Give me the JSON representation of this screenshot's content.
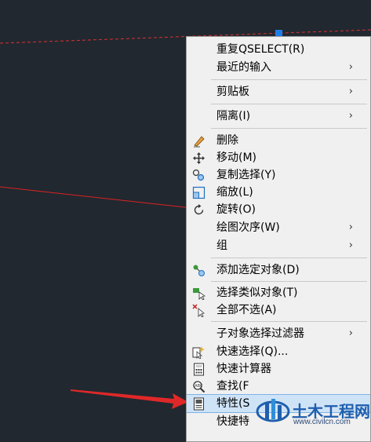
{
  "context_menu": {
    "items": [
      {
        "label": "重复QSELECT(R)",
        "icon": "",
        "submenu": false
      },
      {
        "label": "最近的输入",
        "icon": "",
        "submenu": true
      },
      {
        "label": "剪贴板",
        "icon": "",
        "submenu": true
      },
      {
        "label": "隔离(I)",
        "icon": "",
        "submenu": true
      },
      {
        "label": "删除",
        "icon": "eraser-icon",
        "submenu": false
      },
      {
        "label": "移动(M)",
        "icon": "move-icon",
        "submenu": false
      },
      {
        "label": "复制选择(Y)",
        "icon": "copy-icon",
        "submenu": false
      },
      {
        "label": "缩放(L)",
        "icon": "scale-icon",
        "submenu": false
      },
      {
        "label": "旋转(O)",
        "icon": "rotate-icon",
        "submenu": false
      },
      {
        "label": "绘图次序(W)",
        "icon": "",
        "submenu": true
      },
      {
        "label": "组",
        "icon": "",
        "submenu": true
      },
      {
        "label": "添加选定对象(D)",
        "icon": "add-selected-icon",
        "submenu": false
      },
      {
        "label": "选择类似对象(T)",
        "icon": "select-similar-icon",
        "submenu": false
      },
      {
        "label": "全部不选(A)",
        "icon": "deselect-all-icon",
        "submenu": false
      },
      {
        "label": "子对象选择过滤器",
        "icon": "",
        "submenu": true
      },
      {
        "label": "快速选择(Q)...",
        "icon": "quick-select-icon",
        "submenu": false
      },
      {
        "label": "快速计算器",
        "icon": "calculator-icon",
        "submenu": false
      },
      {
        "label": "查找(F",
        "icon": "find-icon",
        "submenu": false
      },
      {
        "label": "特性(S",
        "icon": "properties-icon",
        "submenu": false,
        "highlighted": true
      },
      {
        "label": "快捷特",
        "icon": "",
        "submenu": false
      }
    ],
    "submenu_arrow": "›"
  },
  "watermark": {
    "name": "土木工程网",
    "url": "www.civilcn.com"
  },
  "colors": {
    "canvas_bg": "#212830",
    "menu_bg": "#f0f0f0",
    "highlight": "#cfe3f7",
    "dashed_line": "#e03030",
    "pointer_arrow": "#e02828",
    "grip": "#1e7ee8"
  }
}
